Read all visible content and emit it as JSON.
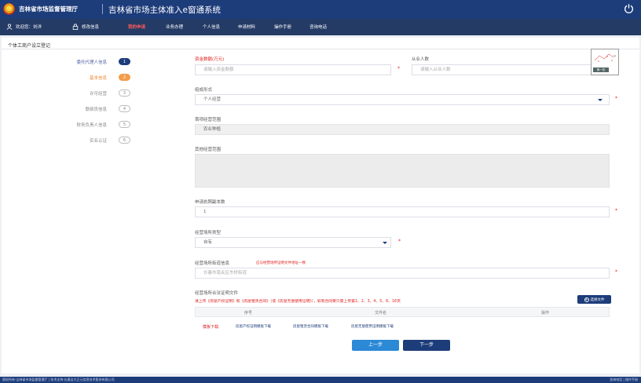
{
  "header": {
    "agency": "吉林省市场监督管理厅",
    "system_title": "吉林省市场主体准入e窗通系统"
  },
  "nav": {
    "welcome": "欢迎您：刘洋",
    "items": [
      "修改信息",
      "我的申请",
      "业务办理",
      "个人信息",
      "申请材料",
      "操作手册",
      "咨询电话"
    ],
    "active": "我的申请"
  },
  "panel": {
    "title": "个体工商户设立登记"
  },
  "steps": [
    {
      "label": "委托代理人信息",
      "num": "1",
      "state": "current"
    },
    {
      "label": "基本信息",
      "num": "2",
      "state": "active"
    },
    {
      "label": "许可经营",
      "num": "3",
      "state": "todo"
    },
    {
      "label": "联络员信息",
      "num": "4",
      "state": "todo"
    },
    {
      "label": "财务负责人信息",
      "num": "5",
      "state": "todo"
    },
    {
      "label": "实名认证",
      "num": "6",
      "state": "todo"
    }
  ],
  "form": {
    "capital": {
      "label": "资金数额",
      "unit": "(万元)",
      "placeholder": "请输入资金数额",
      "required": "*"
    },
    "employees": {
      "label": "从业人数",
      "placeholder": "请输入从业人数"
    },
    "org_form": {
      "label": "组成形式",
      "value": "个人经营",
      "required": "*"
    },
    "main_scope": {
      "label": "首项经营范围",
      "value": "农业种植"
    },
    "other_scope": {
      "label": "其他经营范围"
    },
    "license_copies": {
      "label": "申请执照副本数",
      "value": "1",
      "required": "*"
    },
    "site_type": {
      "label": "经营场所类型",
      "value": "自有",
      "required": "*"
    },
    "site_address": {
      "label": "经营场所街道信息",
      "hint": "应与经营场所证明文件地址一致",
      "placeholder": "长春市南关区东桥街道",
      "required": "*"
    },
    "site_proof": {
      "label": "经营场所合法证明文件",
      "note": "请上传《房屋产权证明》和《房屋租赁合同》（或《房屋无偿使用证明》），如有合同要只需上传第1、2、3、4、5、6、16页",
      "upload_btn": "选择文件"
    }
  },
  "table": {
    "columns": [
      "序号",
      "文件名",
      "操作"
    ]
  },
  "templates": {
    "label": "模板下载:",
    "links": [
      "房屋产权证明模板下载",
      "房屋租赁合同模板下载",
      "房屋无偿使用证明模板下载"
    ]
  },
  "buttons": {
    "prev": "上一步",
    "next": "下一步"
  },
  "captcha": {
    "refresh": "换一张"
  },
  "footer": {
    "left": "版权所有:吉林省市场监督管理厅 | 技术支持:长春吉大正元信息技术股份有限公司",
    "right": "咨询电话 | 操作手册"
  },
  "colors": {
    "brand": "#1d3c7a",
    "accent": "#f39c4a",
    "required": "#e02020",
    "link": "#2b89d6"
  }
}
